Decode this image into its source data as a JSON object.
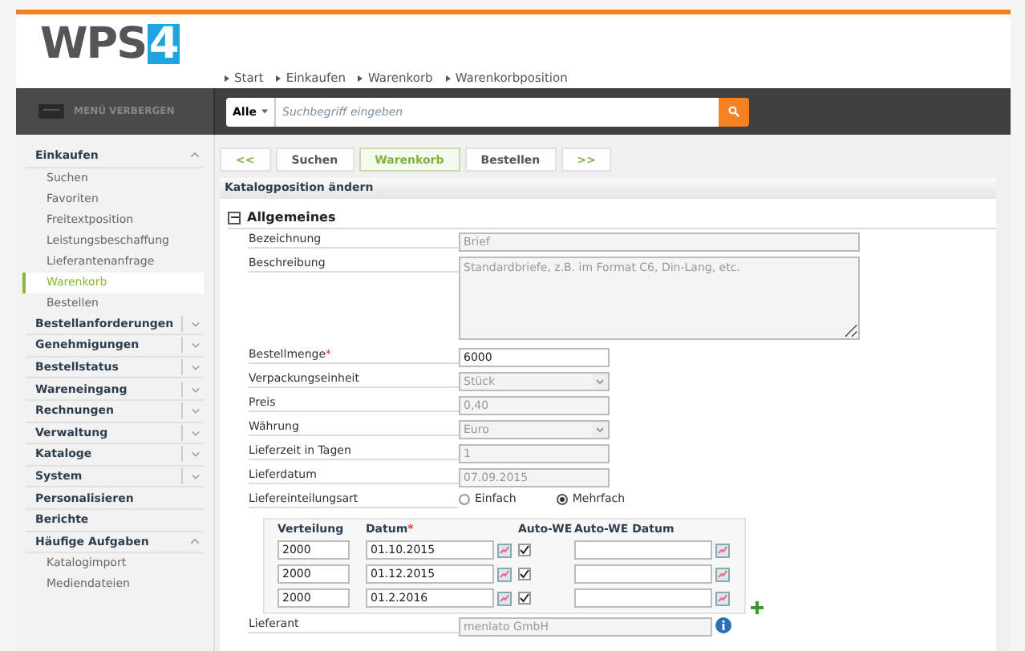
{
  "header": {
    "logo_text": "WPS",
    "logo_digit": "4",
    "breadcrumb": [
      "Start",
      "Einkaufen",
      "Warenkorb",
      "Warenkorbposition"
    ]
  },
  "topbar": {
    "menu_toggle": "MENÜ VERBERGEN",
    "scope": "Alle",
    "search": {
      "placeholder": "Suchbegriff eingeben"
    }
  },
  "sidebar": {
    "groups": [
      {
        "label": "Einkaufen",
        "kind": "expandable",
        "expanded": true,
        "children": [
          {
            "label": "Suchen",
            "selected": false
          },
          {
            "label": "Favoriten",
            "selected": false
          },
          {
            "label": "Freitextposition",
            "selected": false
          },
          {
            "label": "Leistungsbeschaffung",
            "selected": false
          },
          {
            "label": "Lieferantenanfrage",
            "selected": false
          },
          {
            "label": "Warenkorb",
            "selected": true
          },
          {
            "label": "Bestellen",
            "selected": false
          }
        ]
      },
      {
        "label": "Bestellanforderungen",
        "kind": "expandable",
        "expanded": false
      },
      {
        "label": "Genehmigungen",
        "kind": "expandable",
        "expanded": false
      },
      {
        "label": "Bestellstatus",
        "kind": "expandable",
        "expanded": false
      },
      {
        "label": "Wareneingang",
        "kind": "expandable",
        "expanded": false
      },
      {
        "label": "Rechnungen",
        "kind": "expandable",
        "expanded": false
      },
      {
        "label": "Verwaltung",
        "kind": "expandable",
        "expanded": false
      },
      {
        "label": "Kataloge",
        "kind": "expandable",
        "expanded": false
      },
      {
        "label": "System",
        "kind": "expandable",
        "expanded": false
      },
      {
        "label": "Personalisieren",
        "kind": "link"
      },
      {
        "label": "Berichte",
        "kind": "link"
      },
      {
        "label": "Häufige Aufgaben",
        "kind": "expandable",
        "expanded": true,
        "children": [
          {
            "label": "Katalogimport",
            "selected": false
          },
          {
            "label": "Mediendateien",
            "selected": false
          }
        ]
      }
    ]
  },
  "steps": [
    {
      "label": "<<",
      "kind": "arrow",
      "selected": false
    },
    {
      "label": "Suchen",
      "kind": "step",
      "selected": false
    },
    {
      "label": "Warenkorb",
      "kind": "step",
      "selected": true
    },
    {
      "label": "Bestellen",
      "kind": "step",
      "selected": false
    },
    {
      "label": ">>",
      "kind": "arrow",
      "selected": false
    }
  ],
  "panel_title": "Katalogposition ändern",
  "section": {
    "title": "Allgemeines",
    "expanded": true
  },
  "fields": [
    {
      "label": "Bezeichnung",
      "kind": "wide",
      "value": "Brief",
      "disabled": true
    },
    {
      "label": "Beschreibung",
      "kind": "textarea",
      "value": "Standardbriefe, z.B. im Format C6, Din-Lang, etc.",
      "disabled": true
    },
    {
      "label": "Bestellmenge",
      "required_mark": "*",
      "kind": "text",
      "value": "6000",
      "disabled": false
    },
    {
      "label": "Verpackungseinheit",
      "kind": "select",
      "value": "Stück",
      "disabled": true
    },
    {
      "label": "Preis",
      "kind": "text",
      "value": "0,40",
      "disabled": true
    },
    {
      "label": "Währung",
      "kind": "select",
      "value": "Euro",
      "disabled": true
    },
    {
      "label": "Lieferzeit in Tagen",
      "kind": "text",
      "value": "1",
      "disabled": true
    },
    {
      "label": "Lieferdatum",
      "kind": "text",
      "value": "07.09.2015",
      "disabled": true
    },
    {
      "label": "Liefereinteilungsart",
      "kind": "radio",
      "options": [
        {
          "label": "Einfach",
          "selected": false
        },
        {
          "label": "Mehrfach",
          "selected": true
        }
      ]
    },
    {
      "label": "Lieferant",
      "kind": "lookup",
      "value": "menlato GmbH",
      "disabled": true
    }
  ],
  "distribution": {
    "columns": [
      {
        "label": "Verteilung"
      },
      {
        "label": "Datum",
        "required_mark": "*"
      },
      {
        "label": "Auto-WE"
      },
      {
        "label": "Auto-WE Datum"
      }
    ],
    "rows": [
      {
        "amount": "2000",
        "date": "01.10.2015",
        "auto_we": true
      },
      {
        "amount": "2000",
        "date": "01.12.2015",
        "auto_we": true
      },
      {
        "amount": "2000",
        "date": "01.2.2016",
        "auto_we": true
      }
    ]
  }
}
